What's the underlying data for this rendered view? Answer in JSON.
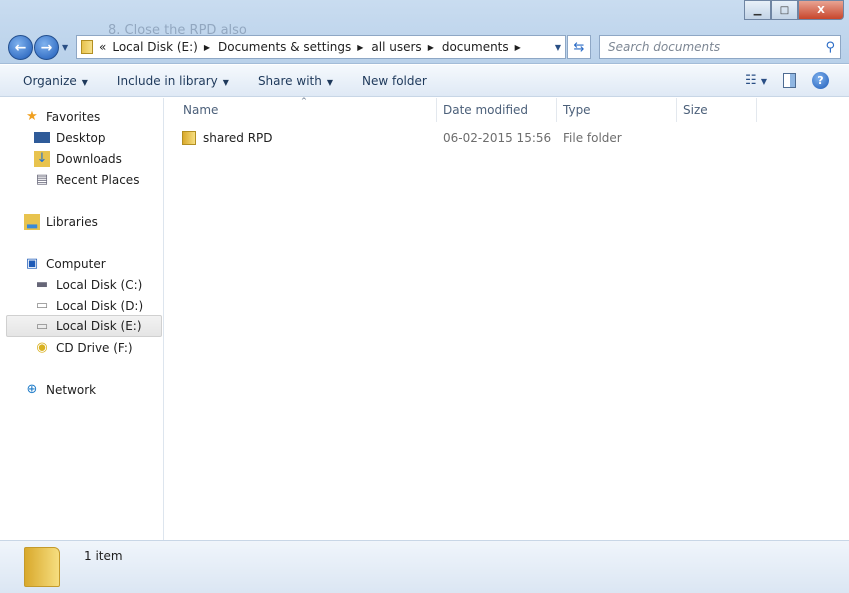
{
  "background_text": "8.  Close the RPD also",
  "window": {
    "minimize": "▭",
    "maximize": "□",
    "close": "X"
  },
  "address": {
    "overflow": "«",
    "crumbs": [
      "Local Disk (E:)",
      "Documents & settings",
      "all users",
      "documents"
    ]
  },
  "search": {
    "placeholder": "Search documents"
  },
  "toolbar": {
    "organize": "Organize",
    "include": "Include in library",
    "share": "Share with",
    "new_folder": "New folder",
    "help": "?"
  },
  "sidebar": {
    "favorites": "Favorites",
    "desktop": "Desktop",
    "downloads": "Downloads",
    "recent": "Recent Places",
    "libraries": "Libraries",
    "computer": "Computer",
    "c": "Local Disk (C:)",
    "d": "Local Disk (D:)",
    "e": "Local Disk (E:)",
    "f": "CD Drive (F:)",
    "network": "Network"
  },
  "columns": {
    "name": "Name",
    "date": "Date modified",
    "type": "Type",
    "size": "Size"
  },
  "files": [
    {
      "name": "shared RPD",
      "date": "06-02-2015 15:56",
      "type": "File folder",
      "size": ""
    }
  ],
  "status": {
    "count": "1 item"
  }
}
